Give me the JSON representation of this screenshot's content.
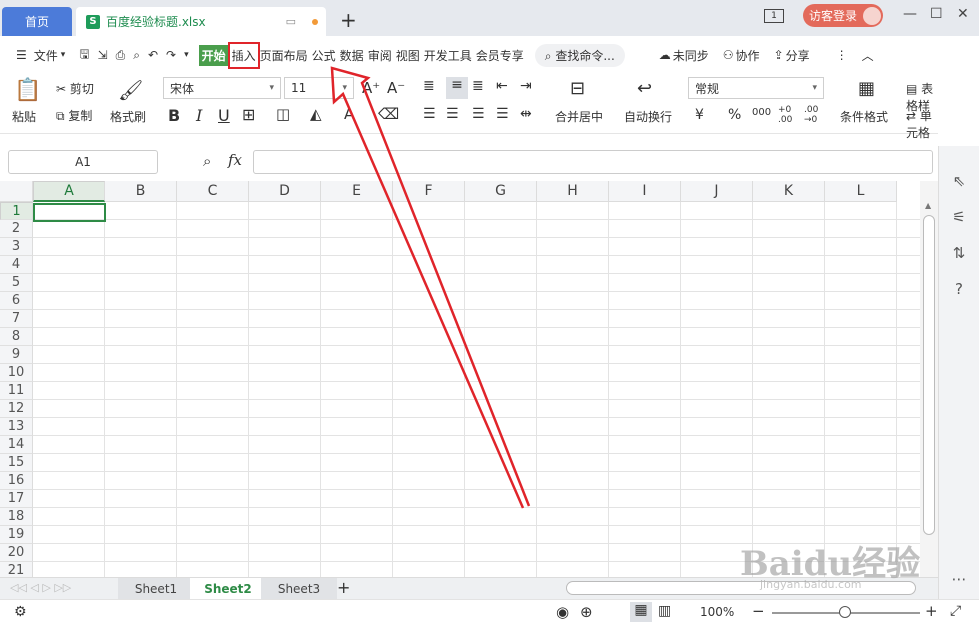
{
  "titlebar": {
    "home_tab": "首页",
    "file_tab": "百度经验标题.xlsx",
    "file_icon": "S",
    "window_count": "1",
    "login": "访客登录",
    "window_min": "—",
    "window_max": "☐",
    "window_close": "✕"
  },
  "menu": {
    "file": "文件",
    "items": [
      "开始",
      "插入",
      "页面布局",
      "公式",
      "数据",
      "审阅",
      "视图",
      "开发工具",
      "会员专享"
    ],
    "search": "查找命令...",
    "unsync": "未同步",
    "collab": "协作",
    "share": "分享"
  },
  "ribbon": {
    "paste": "粘贴",
    "cut": "剪切",
    "copy": "复制",
    "format_painter": "格式刷",
    "font_name": "宋体",
    "font_size": "11",
    "merge_center": "合并居中",
    "auto_wrap": "自动换行",
    "number_format": "常规",
    "cond_format": "条件格式",
    "table_style": "表格样",
    "cell_style": "单元格"
  },
  "formula": {
    "name_box": "A1",
    "fx": "fx",
    "value": ""
  },
  "grid": {
    "columns": [
      "A",
      "B",
      "C",
      "D",
      "E",
      "F",
      "G",
      "H",
      "I",
      "J",
      "K",
      "L"
    ],
    "rows": [
      "1",
      "2",
      "3",
      "4",
      "5",
      "6",
      "7",
      "8",
      "9",
      "10",
      "11",
      "12",
      "13",
      "14",
      "15",
      "16",
      "17",
      "18",
      "19",
      "20",
      "21"
    ],
    "active_cell": "A1"
  },
  "sheets": {
    "tabs": [
      "Sheet1",
      "Sheet2",
      "Sheet3"
    ],
    "active": "Sheet2",
    "add": "+"
  },
  "status": {
    "zoom": "100%",
    "zoom_minus": "−",
    "zoom_plus": "+"
  },
  "watermark": {
    "main": "Baidu经验",
    "url": "jingyan.baidu.com"
  },
  "colors": {
    "accent_green": "#2e8b46",
    "home_tab_blue": "#4c7bd9",
    "login_red": "#e36a5b",
    "annotation_red": "#e0242a"
  }
}
